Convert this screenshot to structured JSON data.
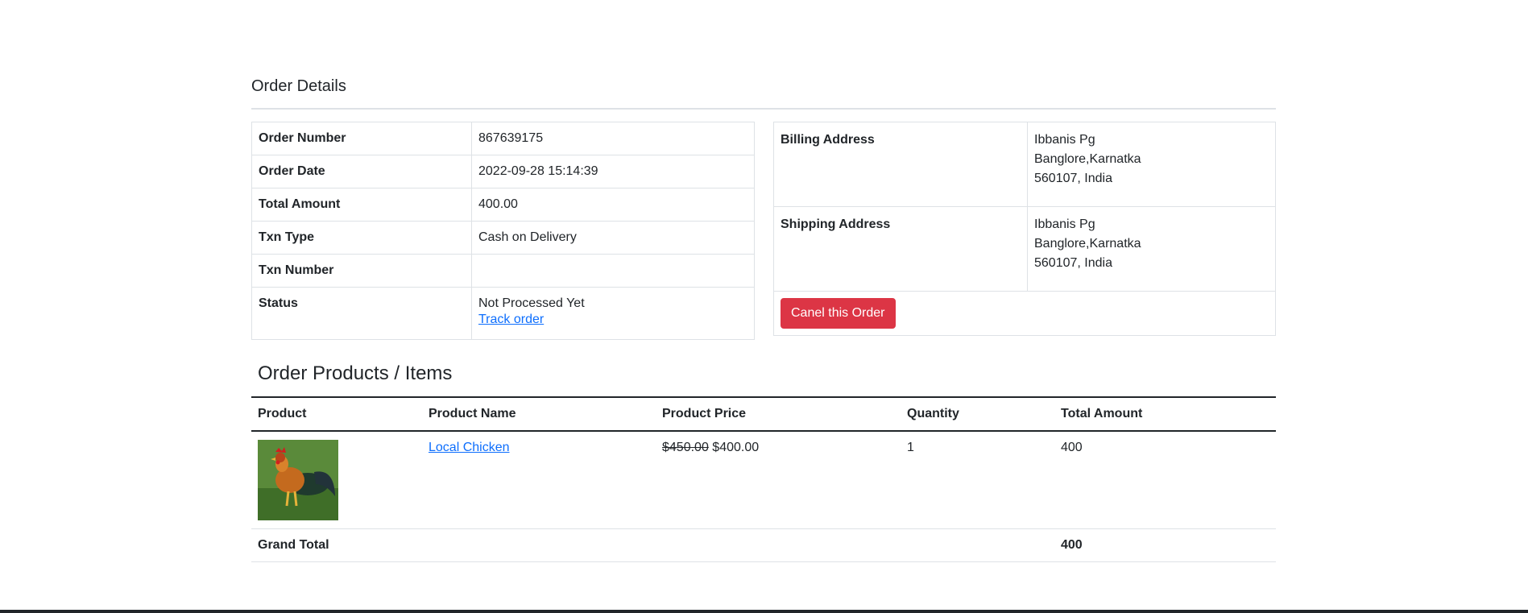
{
  "page": {
    "section_title": "Order Details"
  },
  "order": {
    "rows": [
      {
        "label": "Order Number",
        "value": "867639175"
      },
      {
        "label": "Order Date",
        "value": "2022-09-28 15:14:39"
      },
      {
        "label": "Total Amount",
        "value": "400.00"
      },
      {
        "label": "Txn Type",
        "value": "Cash on Delivery"
      },
      {
        "label": "Txn Number",
        "value": ""
      }
    ],
    "status": {
      "label": "Status",
      "value": "Not Processed Yet",
      "track_link": "Track order"
    }
  },
  "addresses": {
    "billing": {
      "label": "Billing Address",
      "lines": [
        "Ibbanis Pg",
        "Banglore,Karnatka",
        "560107, India"
      ]
    },
    "shipping": {
      "label": "Shipping Address",
      "lines": [
        "Ibbanis Pg",
        "Banglore,Karnatka",
        "560107, India"
      ]
    },
    "cancel_button": "Canel this Order"
  },
  "items": {
    "title": "Order Products / Items",
    "headers": [
      "Product",
      "Product Name",
      "Product Price",
      "Quantity",
      "Total Amount"
    ],
    "rows": [
      {
        "image_icon": "rooster-image",
        "name": "Local Chicken",
        "old_price": "$450.00",
        "price": "$400.00",
        "quantity": "1",
        "total": "400"
      }
    ],
    "grand_total_label": "Grand Total",
    "grand_total_value": "400"
  },
  "colors": {
    "danger": "#dc3545",
    "link": "#0d6efd",
    "border": "#dee2e6"
  }
}
